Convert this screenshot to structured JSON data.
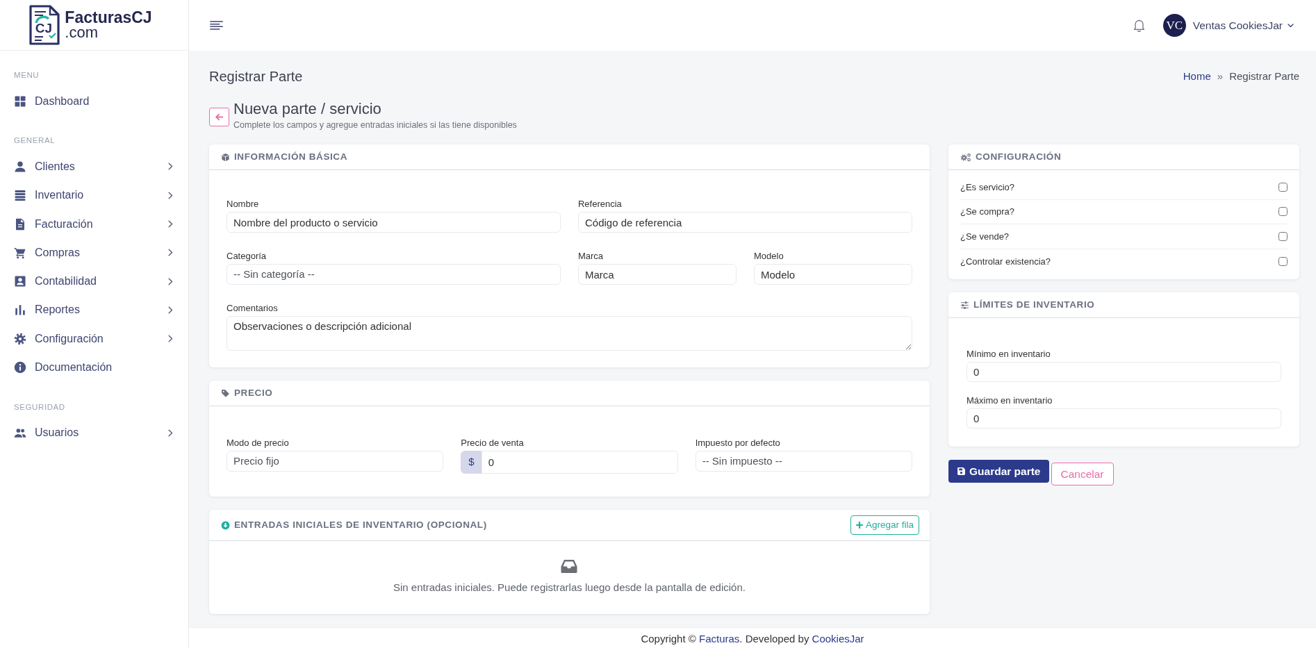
{
  "brand": {
    "mark": "CJ",
    "name": "FacturasCJ",
    "domain": ".com"
  },
  "sidebar": {
    "sections": [
      {
        "title": "MENU",
        "items": [
          {
            "label": "Dashboard",
            "submenu": false
          }
        ]
      },
      {
        "title": "GENERAL",
        "items": [
          {
            "label": "Clientes",
            "submenu": true
          },
          {
            "label": "Inventario",
            "submenu": true
          },
          {
            "label": "Facturación",
            "submenu": true
          },
          {
            "label": "Compras",
            "submenu": true
          },
          {
            "label": "Contabilidad",
            "submenu": true
          },
          {
            "label": "Reportes",
            "submenu": true
          },
          {
            "label": "Configuración",
            "submenu": true
          },
          {
            "label": "Documentación",
            "submenu": false
          }
        ]
      },
      {
        "title": "SEGURIDAD",
        "items": [
          {
            "label": "Usuarios",
            "submenu": true
          }
        ]
      }
    ]
  },
  "topbar": {
    "user": {
      "initials": "VC",
      "name": "Ventas CookiesJar"
    }
  },
  "page": {
    "title": "Registrar Parte",
    "breadcrumb_separator": "»",
    "breadcrumb": [
      {
        "label": "Home",
        "link": true
      },
      {
        "label": "Registrar Parte",
        "link": false
      }
    ]
  },
  "form_heading": {
    "title": "Nueva parte / servicio",
    "subtitle": "Complete los campos y agregue entradas iniciales si las tiene disponibles"
  },
  "basic_info": {
    "title": "INFORMACIÓN BÁSICA",
    "rows": [
      [
        {
          "kind": "text",
          "label": "Nombre",
          "placeholder": "Nombre del producto o servicio"
        },
        {
          "kind": "text",
          "label": "Referencia",
          "placeholder": "Código de referencia"
        }
      ],
      [
        {
          "kind": "select",
          "label": "Categoría",
          "value": "-- Sin categoría --"
        },
        {
          "kind": "text",
          "label": "Marca",
          "placeholder": "Marca"
        },
        {
          "kind": "text",
          "label": "Modelo",
          "placeholder": "Modelo"
        }
      ],
      [
        {
          "kind": "textarea",
          "label": "Comentarios",
          "placeholder": "Observaciones o descripción adicional"
        }
      ]
    ]
  },
  "price": {
    "title": "PRECIO",
    "fields": [
      {
        "kind": "select",
        "label": "Modo de precio",
        "value": "Precio fijo"
      },
      {
        "kind": "money",
        "label": "Precio de venta",
        "prefix": "$",
        "value": "0"
      },
      {
        "kind": "select",
        "label": "Impuesto por defecto",
        "value": "-- Sin impuesto --"
      }
    ]
  },
  "initial_entries": {
    "title": "ENTRADAS INICIALES DE INVENTARIO (OPCIONAL)",
    "add_button": "Agregar fila",
    "empty_text": "Sin entradas iniciales. Puede registrarlas luego desde la pantalla de edición."
  },
  "config": {
    "title": "CONFIGURACIÓN",
    "options": [
      {
        "label": "¿Es servicio?",
        "checked": false
      },
      {
        "label": "¿Se compra?",
        "checked": false
      },
      {
        "label": "¿Se vende?",
        "checked": false
      },
      {
        "label": "¿Controlar existencia?",
        "checked": false
      }
    ]
  },
  "limits": {
    "title": "LÍMITES DE INVENTARIO",
    "fields": [
      {
        "label": "Mínimo en inventario",
        "value": "0"
      },
      {
        "label": "Máximo en inventario",
        "value": "0"
      }
    ]
  },
  "actions": [
    {
      "kind": "primary",
      "label": "Guardar parte"
    },
    {
      "kind": "cancel",
      "label": "Cancelar"
    }
  ],
  "footer": [
    {
      "kind": "text",
      "text": "Copyright © "
    },
    {
      "kind": "link",
      "text": "Facturas"
    },
    {
      "kind": "text",
      "text": ". Developed by "
    },
    {
      "kind": "link",
      "text": "CookiesJar"
    }
  ]
}
